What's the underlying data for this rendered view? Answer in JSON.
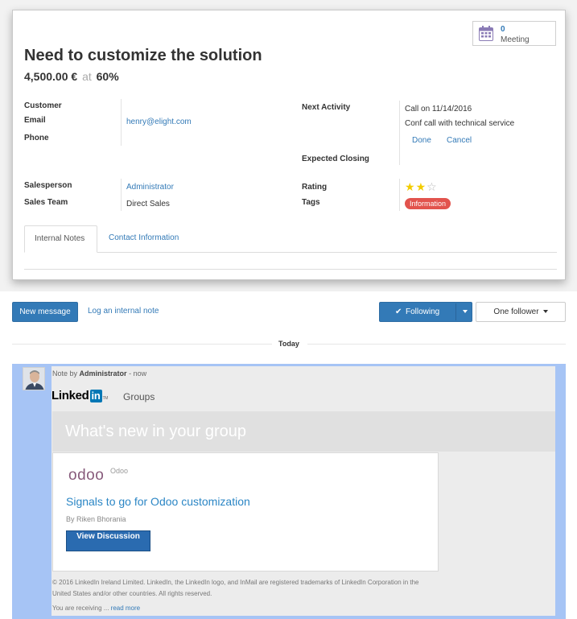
{
  "stat_button": {
    "count": "0",
    "label": "Meeting"
  },
  "record": {
    "title": "Need to customize the solution",
    "amount": "4,500.00 €",
    "at": "at",
    "probability": "60%"
  },
  "fields": {
    "customer_label": "Customer",
    "email_label": "Email",
    "email_value": "henry@elight.com",
    "phone_label": "Phone",
    "next_activity_label": "Next Activity",
    "activity_line": "Call  on  11/14/2016",
    "activity_summary": "Conf call with technical service",
    "done_label": "Done",
    "cancel_label": "Cancel",
    "expected_closing_label": "Expected Closing",
    "salesperson_label": "Salesperson",
    "salesperson_value": "Administrator",
    "sales_team_label": "Sales Team",
    "sales_team_value": "Direct Sales",
    "rating_label": "Rating",
    "rating": 2,
    "rating_max": 3,
    "tags_label": "Tags",
    "tag_value": "Information",
    "tag_color": "#e2534d"
  },
  "tabs": [
    {
      "label": "Internal Notes",
      "active": true
    },
    {
      "label": "Contact Information",
      "active": false
    }
  ],
  "chatter": {
    "new_message": "New message",
    "log_note": "Log an internal note",
    "following": "Following",
    "followers": "One follower",
    "date_separator": "Today"
  },
  "message": {
    "prefix": "Note by",
    "author": "Administrator",
    "time": "- now",
    "logo_text": "Linked",
    "logo_in": "in",
    "logo_tm": "TM",
    "groups": "Groups",
    "banner": "What's new in your group",
    "group_logo": "odoo",
    "group_name": "Odoo",
    "post_title": "Signals to go for Odoo customization",
    "byline": "By Riken Bhorania",
    "view_button": "View Discussion",
    "copyright": "© 2016 LinkedIn Ireland Limited. LinkedIn, the LinkedIn logo, and InMail are registered trademarks of LinkedIn Corporation in the United States and/or other countries. All rights reserved.",
    "receiving": "You are receiving ...",
    "read_more": "read more"
  },
  "colors": {
    "accent": "#337ab7",
    "highlight": "#a6c4f5",
    "star": "#f3cc00"
  }
}
